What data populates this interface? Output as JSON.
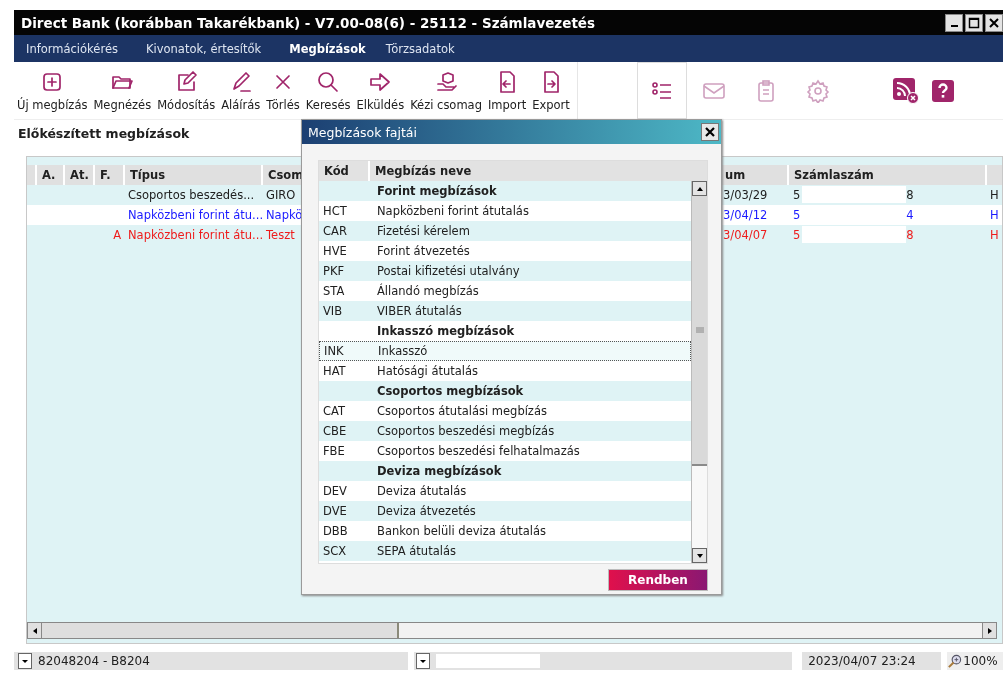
{
  "window": {
    "title": "Direct Bank (korábban Takarékbank) - V7.00-08(6) - 25112 - Számlavezetés"
  },
  "menu": [
    {
      "label": "Információkérés",
      "selected": false
    },
    {
      "label": "Kivonatok, értesítők",
      "selected": false
    },
    {
      "label": "Megbízások",
      "selected": true
    },
    {
      "label": "Törzsadatok",
      "selected": false
    }
  ],
  "toolbar": [
    "Új megbízás",
    "Megnézés",
    "Módosítás",
    "Aláírás",
    "Törlés",
    "Keresés",
    "Elküldés",
    "Kézi csomag",
    "Import",
    "Export"
  ],
  "view_tools": [
    {
      "selected": true
    },
    {
      "selected": false
    },
    {
      "selected": false
    },
    {
      "selected": false
    }
  ],
  "section_title": "Előkészített megbízások",
  "table": {
    "columns": [
      "A.",
      "At.",
      "F.",
      "Típus",
      "Csom",
      "um",
      "Számlaszám"
    ],
    "rows": [
      {
        "type": "Csoportos beszedés...",
        "package": "GIRO",
        "date": "3/03/29",
        "account_start": "5",
        "account_end": "8",
        "column_9": "H",
        "color": "#202020"
      },
      {
        "type": "Napközbeni forint átu...",
        "package": "Napkö",
        "date": "3/04/12",
        "account_start": "5",
        "account_end": "4",
        "column_9": "H",
        "color": "#1a1aff"
      },
      {
        "f": "A",
        "type": "Napközbeni forint átu...",
        "package": "Teszt",
        "date": "3/04/07",
        "account_start": "5",
        "account_end": "8",
        "column_9": "H",
        "color": "#ee1c1c"
      }
    ]
  },
  "dialog": {
    "title": "Megbízások fajtái",
    "columns": [
      "Kód",
      "Megbízás neve"
    ],
    "rows": [
      {
        "kind": "group",
        "name": "Forint megbízások",
        "selected": false
      },
      {
        "kind": "item",
        "code": "HCT",
        "name": "Napközbeni forint átutalás",
        "selected": false
      },
      {
        "kind": "item",
        "code": "CAR",
        "name": "Fizetési kérelem",
        "selected": false
      },
      {
        "kind": "item",
        "code": "HVE",
        "name": "Forint átvezetés",
        "selected": false
      },
      {
        "kind": "item",
        "code": "PKF",
        "name": "Postai kifizetési utalvány",
        "selected": false
      },
      {
        "kind": "item",
        "code": "STA",
        "name": "Állandó megbízás",
        "selected": false
      },
      {
        "kind": "item",
        "code": "VIB",
        "name": "VIBER átutalás",
        "selected": false
      },
      {
        "kind": "group",
        "name": "Inkasszó megbízások",
        "selected": false
      },
      {
        "kind": "item",
        "code": "INK",
        "name": "Inkasszó",
        "selected": true
      },
      {
        "kind": "item",
        "code": "HAT",
        "name": "Hatósági átutalás",
        "selected": false
      },
      {
        "kind": "group",
        "name": "Csoportos megbízások",
        "selected": false
      },
      {
        "kind": "item",
        "code": "CAT",
        "name": "Csoportos átutalási megbízás",
        "selected": false
      },
      {
        "kind": "item",
        "code": "CBE",
        "name": "Csoportos beszedési megbízás",
        "selected": false
      },
      {
        "kind": "item",
        "code": "FBE",
        "name": "Csoportos beszedési felhatalmazás",
        "selected": false
      },
      {
        "kind": "group",
        "name": "Deviza megbízások",
        "selected": false
      },
      {
        "kind": "item",
        "code": "DEV",
        "name": "Deviza átutalás",
        "selected": false
      },
      {
        "kind": "item",
        "code": "DVE",
        "name": "Deviza átvezetés",
        "selected": false
      },
      {
        "kind": "item",
        "code": "DBB",
        "name": "Bankon belüli deviza átutalás",
        "selected": false
      },
      {
        "kind": "item",
        "code": "SCX",
        "name": "SEPA átutalás",
        "selected": false
      }
    ],
    "ok_button": "Rendben"
  },
  "status_bar": {
    "account": "82048204 - B8204",
    "datetime": "2023/04/07 23:24",
    "zoom": "100%"
  }
}
